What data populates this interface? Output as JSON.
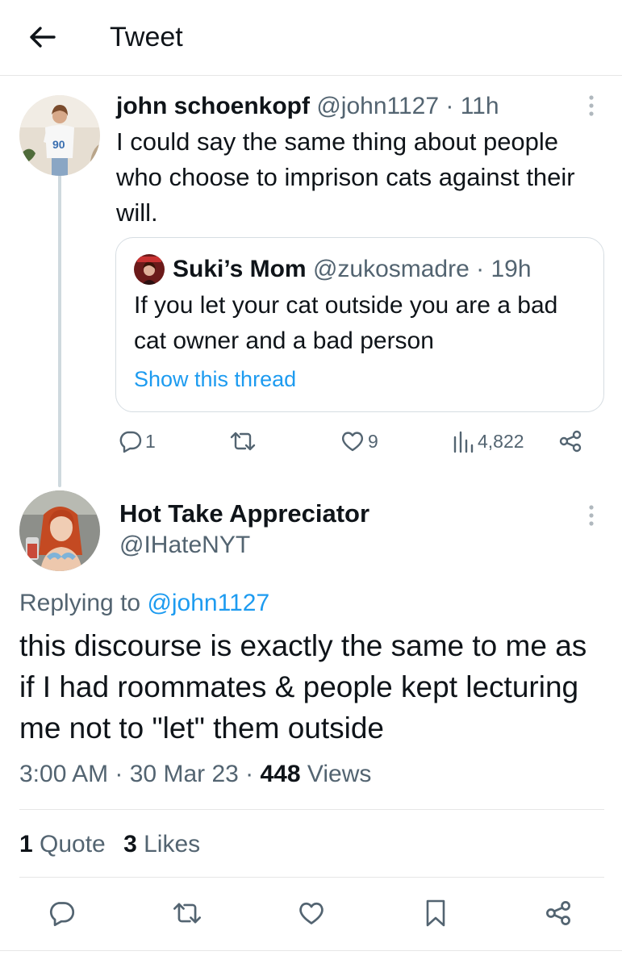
{
  "header": {
    "title": "Tweet"
  },
  "parent_tweet": {
    "name": "john schoenkopf",
    "handle": "@john1127",
    "sep": " · ",
    "time": "11h",
    "text": "I could say the same thing about people who choose to imprison cats against their will.",
    "quote": {
      "name": "Suki’s Mom",
      "handle": "@zukosmadre",
      "sep": " · ",
      "time": "19h",
      "text": "If you let your cat outside you are a bad cat owner and a bad person",
      "link": "Show this thread"
    },
    "actions": {
      "replies": "1",
      "likes": "9",
      "views": "4,822"
    }
  },
  "main_tweet": {
    "name": "Hot Take Appreciator",
    "handle": "@IHateNYT",
    "replying_prefix": "Replying to ",
    "replying_handle": "@john1127",
    "text": "this discourse is exactly the same to me as if I had roommates & people kept lecturing me not to \"let\" them outside",
    "time": "3:00 AM",
    "sep1": " · ",
    "date": "30 Mar 23",
    "sep2": " · ",
    "views_count": "448",
    "views_label": " Views",
    "stats": {
      "quotes_count": "1",
      "quotes_label": " Quote",
      "likes_count": "3",
      "likes_label": " Likes"
    }
  },
  "colors": {
    "accent": "#1d9bf0",
    "muted": "#536471",
    "text": "#0f1419",
    "border": "#e6e6e6"
  },
  "icons": [
    "back-arrow-icon",
    "more-icon",
    "reply-icon",
    "retweet-icon",
    "like-icon",
    "views-icon",
    "share-icon",
    "bookmark-icon"
  ]
}
